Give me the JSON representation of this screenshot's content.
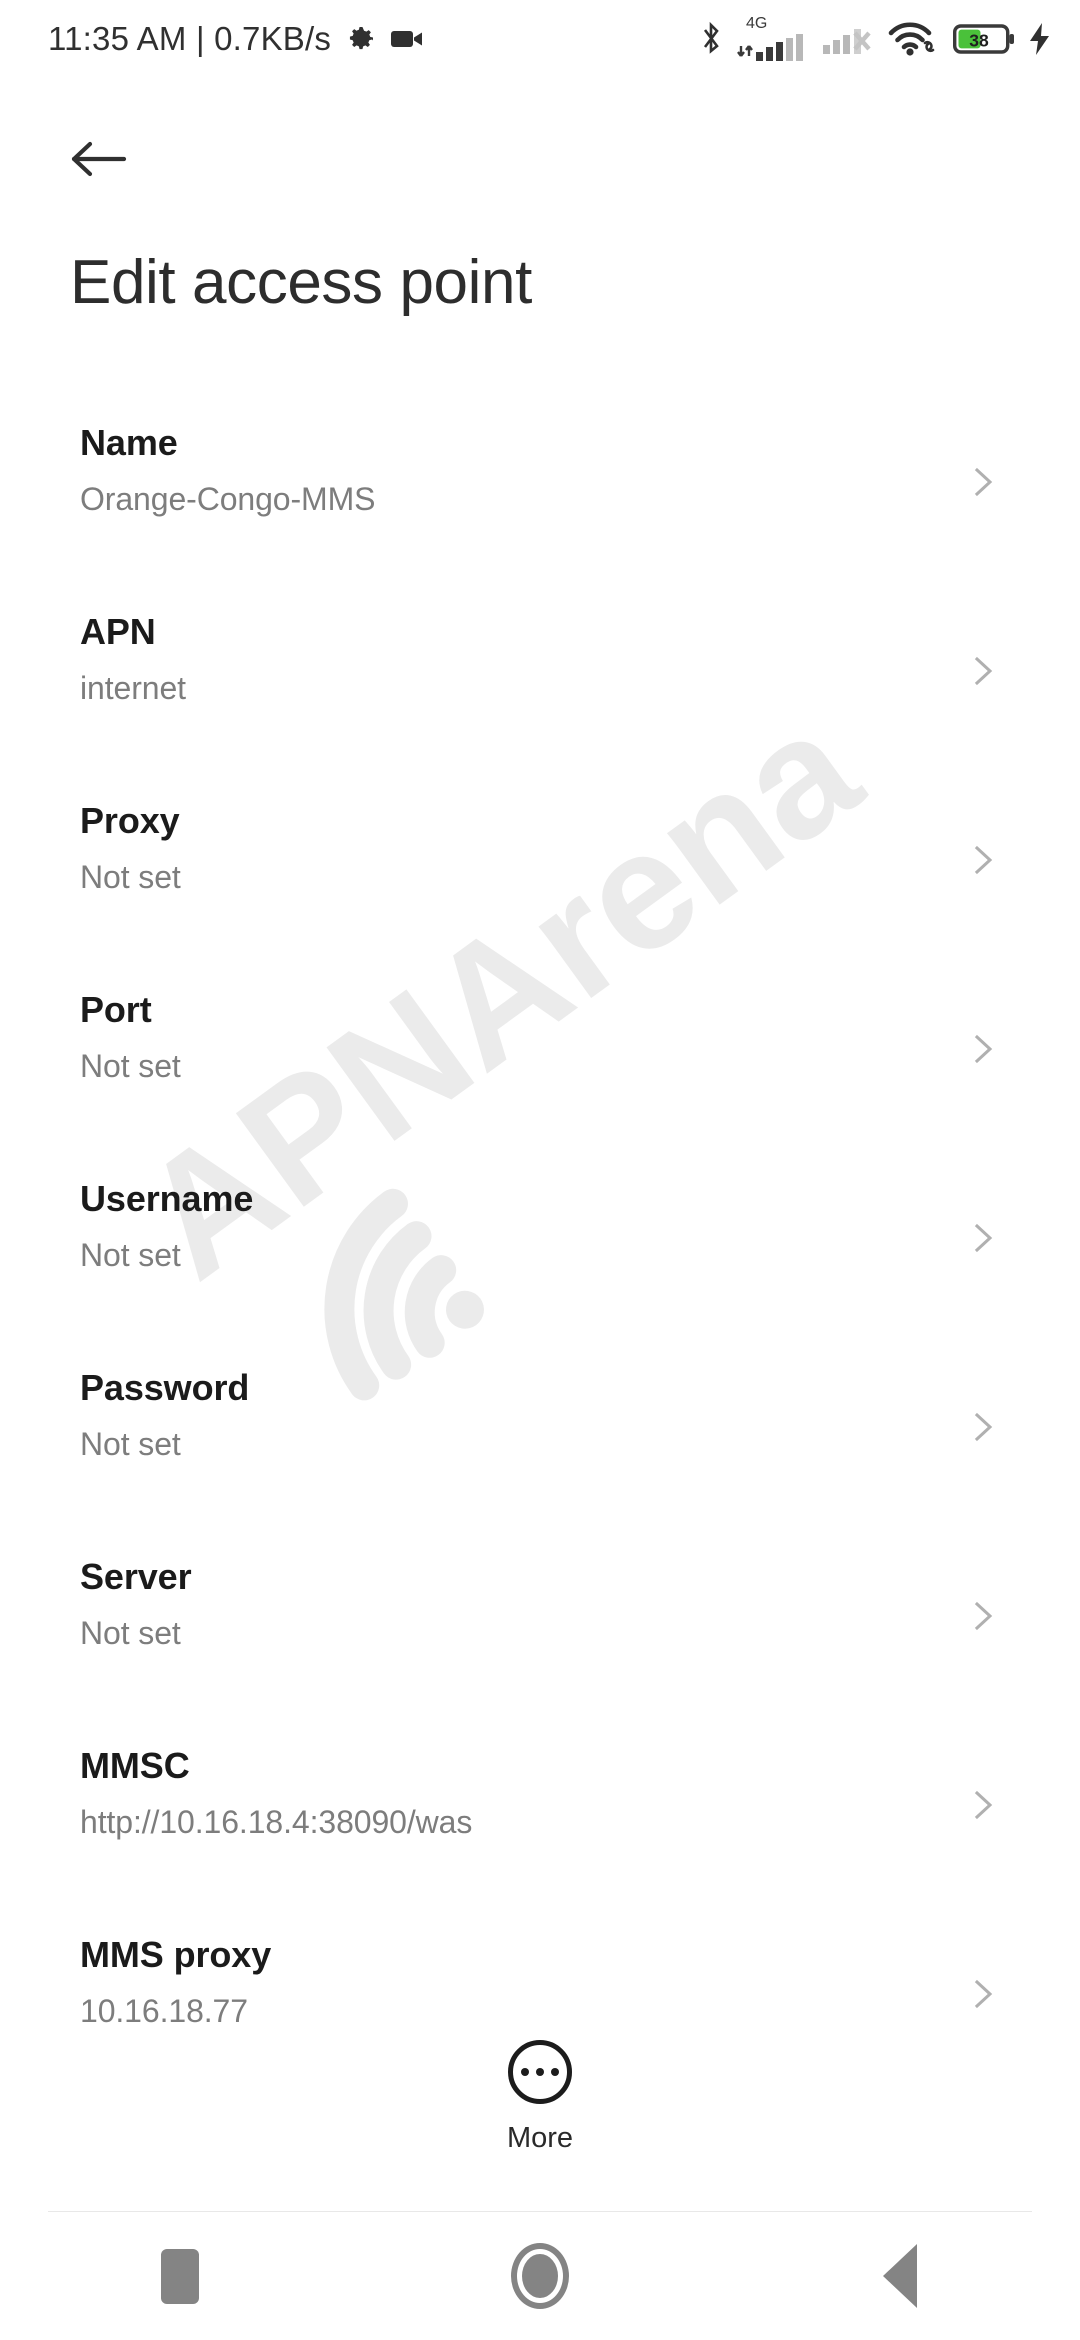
{
  "status_bar": {
    "clock": "11:35 AM | 0.7KB/s",
    "icons": {
      "settings": "gear-icon",
      "recording": "camcorder-icon",
      "bluetooth": "bluetooth-icon",
      "network_type": "4G",
      "signal_sim1": "signal-bars-icon",
      "signal_sim2": "signal-bars-disabled-icon",
      "wifi": "wifi-link-icon",
      "battery": "battery-icon",
      "charging": "charging-bolt-icon"
    },
    "battery_level": "38"
  },
  "header": {
    "back_icon": "arrow-left-icon",
    "title": "Edit access point"
  },
  "watermark": {
    "text": "APNArena",
    "color": "#ebebeb"
  },
  "settings_list": [
    {
      "title": "Name",
      "value": "Orange-Congo-MMS"
    },
    {
      "title": "APN",
      "value": "internet"
    },
    {
      "title": "Proxy",
      "value": "Not set"
    },
    {
      "title": "Port",
      "value": "Not set"
    },
    {
      "title": "Username",
      "value": "Not set"
    },
    {
      "title": "Password",
      "value": "Not set"
    },
    {
      "title": "Server",
      "value": "Not set"
    },
    {
      "title": "MMSC",
      "value": "http://10.16.18.4:38090/was"
    },
    {
      "title": "MMS proxy",
      "value": "10.16.18.77"
    }
  ],
  "more_button": {
    "label": "More",
    "icon": "more-dots-circle-icon"
  },
  "nav_bar": {
    "recents": "square-icon",
    "home": "circle-icon",
    "back": "triangle-left-icon"
  },
  "colors": {
    "background": "#ffffff",
    "title_text": "#2d2d2d",
    "row_title": "#1b1b1b",
    "row_value": "#7d7d7d",
    "chevron": "#b0b0b0",
    "nav_icon": "#848484",
    "battery_green": "#4ac13a"
  }
}
